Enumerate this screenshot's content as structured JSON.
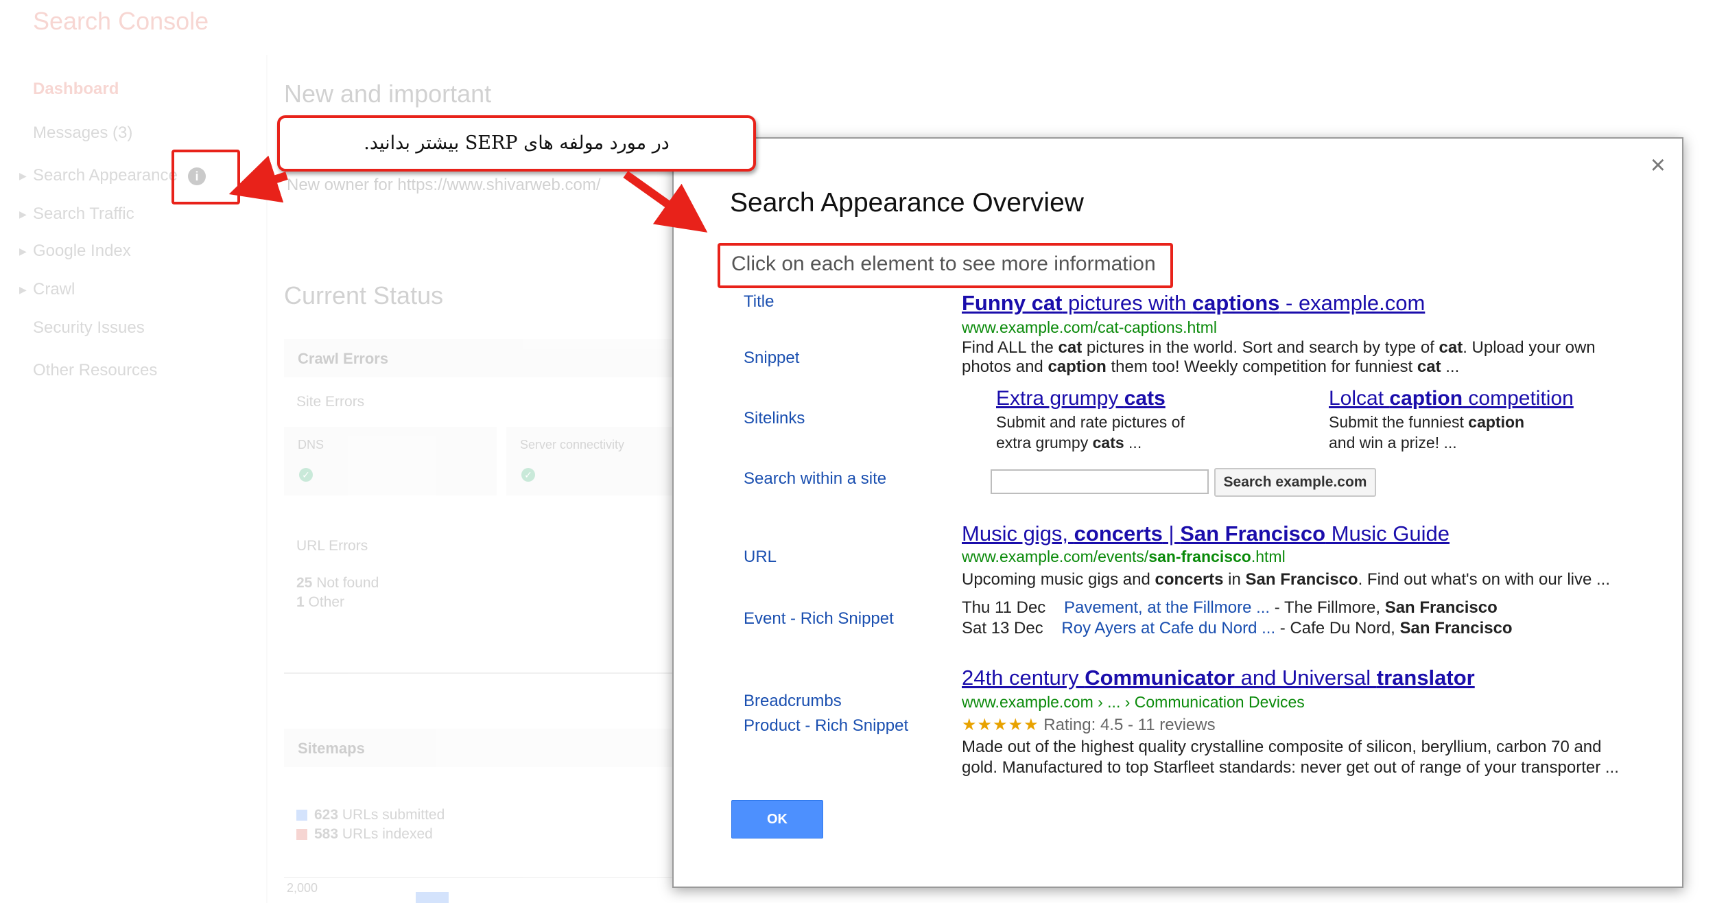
{
  "app": {
    "brand": "Search Console"
  },
  "sidebar": {
    "items": [
      {
        "label": "Dashboard",
        "active": true,
        "expandable": false
      },
      {
        "label": "Messages (3)",
        "active": false,
        "expandable": false
      },
      {
        "label": "Search Appearance",
        "active": false,
        "expandable": true
      },
      {
        "label": "Search Traffic",
        "active": false,
        "expandable": true
      },
      {
        "label": "Google Index",
        "active": false,
        "expandable": true
      },
      {
        "label": "Crawl",
        "active": false,
        "expandable": true
      },
      {
        "label": "Security Issues",
        "active": false,
        "expandable": false
      },
      {
        "label": "Other Resources",
        "active": false,
        "expandable": false
      }
    ],
    "info_icon": "info-icon"
  },
  "main": {
    "new_heading": "New and important",
    "notice": "New owner for https://www.shivarweb.com/",
    "status_heading": "Current Status",
    "crawl_errors": {
      "title": "Crawl Errors",
      "site_errors": "Site Errors",
      "dns_label": "DNS",
      "server_label": "Server connectivity",
      "url_errors": "URL Errors",
      "not_found_count": "25",
      "not_found_label": "Not found",
      "other_count": "1",
      "other_label": "Other"
    },
    "sitemaps": {
      "title": "Sitemaps",
      "submitted_count": "623",
      "submitted_label": "URLs submitted",
      "indexed_count": "583",
      "indexed_label": "URLs indexed",
      "axis_tick": "2,000"
    }
  },
  "dialog": {
    "title": "Search Appearance Overview",
    "subtitle": "Click on each element to see more information",
    "labels": {
      "title": "Title",
      "snippet": "Snippet",
      "sitelinks": "Sitelinks",
      "search_within": "Search within a site",
      "url": "URL",
      "event": "Event - Rich Snippet",
      "breadcrumbs": "Breadcrumbs",
      "product": "Product - Rich Snippet"
    },
    "result1": {
      "title_parts": [
        {
          "text": "Funny cat",
          "bold": true
        },
        {
          "text": " pictures with ",
          "bold": false
        },
        {
          "text": "captions",
          "bold": true
        },
        {
          "text": " - example.com",
          "bold": false
        }
      ],
      "url": "www.example.com/cat-captions.html",
      "snippet_line1_parts": [
        {
          "text": "Find ALL the ",
          "bold": false
        },
        {
          "text": "cat",
          "bold": true
        },
        {
          "text": " pictures in the world. Sort and search by type of ",
          "bold": false
        },
        {
          "text": "cat",
          "bold": true
        },
        {
          "text": ". Upload your own",
          "bold": false
        }
      ],
      "snippet_line2_parts": [
        {
          "text": "photos and ",
          "bold": false
        },
        {
          "text": "caption",
          "bold": true
        },
        {
          "text": " them too! Weekly competition for funniest ",
          "bold": false
        },
        {
          "text": "cat",
          "bold": true
        },
        {
          "text": " ...",
          "bold": false
        }
      ],
      "sitelink1_title_parts": [
        {
          "text": "Extra grumpy ",
          "bold": false
        },
        {
          "text": "cats",
          "bold": true
        }
      ],
      "sitelink1_desc1": "Submit and rate pictures of",
      "sitelink1_desc2_parts": [
        {
          "text": "extra grumpy ",
          "bold": false
        },
        {
          "text": "cats",
          "bold": true
        },
        {
          "text": " ...",
          "bold": false
        }
      ],
      "sitelink2_title_parts": [
        {
          "text": "Lolcat ",
          "bold": false
        },
        {
          "text": "caption",
          "bold": true
        },
        {
          "text": " competition",
          "bold": false
        }
      ],
      "sitelink2_desc1_parts": [
        {
          "text": "Submit the funniest ",
          "bold": false
        },
        {
          "text": "caption",
          "bold": true
        }
      ],
      "sitelink2_desc2": "and win a prize! ...",
      "search_button": "Search example.com"
    },
    "result2": {
      "title_parts": [
        {
          "text": "Music gigs, ",
          "bold": false
        },
        {
          "text": "concerts",
          "bold": true
        },
        {
          "text": " | ",
          "bold": false
        },
        {
          "text": "San Francisco",
          "bold": true
        },
        {
          "text": " Music Guide",
          "bold": false
        }
      ],
      "url_parts": [
        {
          "text": "www.example.com/events/",
          "bold": false
        },
        {
          "text": "san-francisco",
          "bold": true
        },
        {
          "text": ".html",
          "bold": false
        }
      ],
      "snippet_parts": [
        {
          "text": "Upcoming music gigs and ",
          "bold": false
        },
        {
          "text": "concerts",
          "bold": true
        },
        {
          "text": " in ",
          "bold": false
        },
        {
          "text": "San Francisco",
          "bold": true
        },
        {
          "text": ". Find out what's on with our live ...",
          "bold": false
        }
      ],
      "events": [
        {
          "date": "Thu 11 Dec",
          "link": "Pavement, at the Fillmore ...",
          "venue": " - The Fillmore, ",
          "city": "San Francisco"
        },
        {
          "date": "Sat 13 Dec",
          "link": "Roy Ayers at Cafe du Nord ...",
          "venue": " - Cafe Du Nord, ",
          "city": "San Francisco"
        }
      ]
    },
    "result3": {
      "title_parts": [
        {
          "text": "24th century ",
          "bold": false
        },
        {
          "text": "Communicator",
          "bold": true
        },
        {
          "text": " and Universal ",
          "bold": false
        },
        {
          "text": "translator",
          "bold": true
        }
      ],
      "breadcrumb": "www.example.com › ... › Communication Devices",
      "stars": "★★★★★",
      "rating_text": "Rating: 4.5 - 11 reviews",
      "rating_value": 4.5,
      "desc1": "Made out of the highest quality crystalline composite of silicon, beryllium, carbon 70 and",
      "desc2": "gold. Manufactured to top Starfleet standards: never get out of range of your transporter ..."
    },
    "ok_label": "OK",
    "close_symbol": "×"
  },
  "annotation": {
    "callout_text": "در مورد مولفه های SERP بیشتر بدانید.",
    "color": "#e8221a"
  },
  "colors": {
    "brand": "#dd4b39",
    "link": "#1a0dab",
    "url_green": "#0a8a0a",
    "ok_button": "#4d90fe",
    "annotation_red": "#e8221a"
  }
}
